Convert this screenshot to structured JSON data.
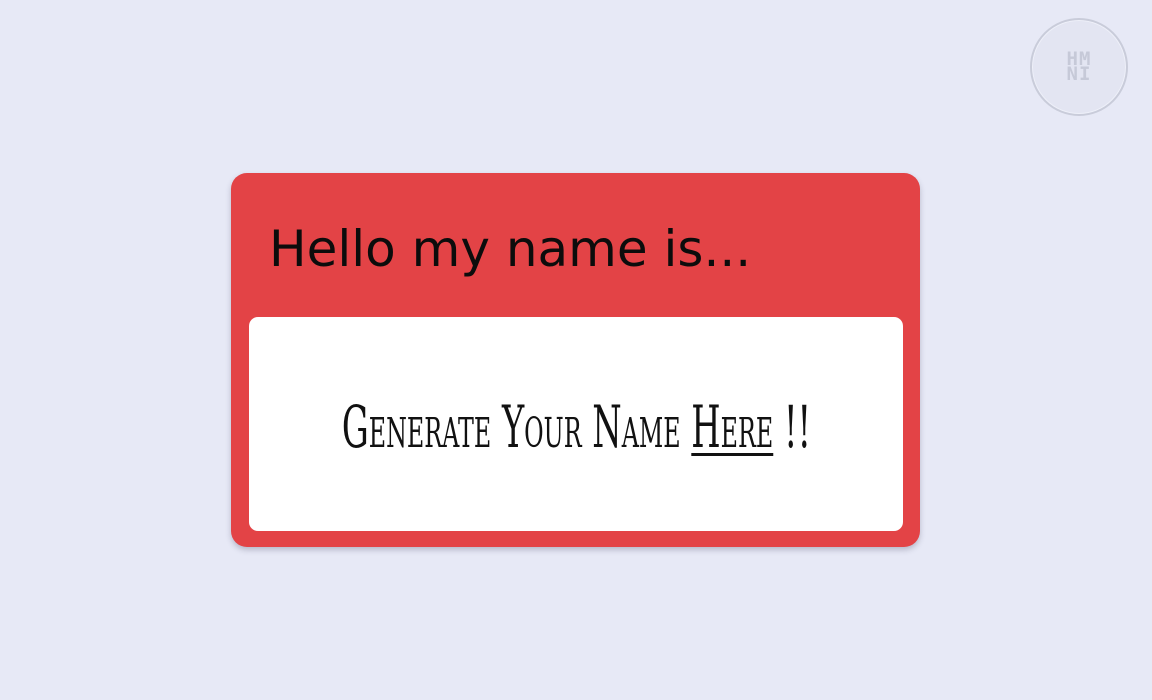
{
  "logo": {
    "line1": "HM",
    "line2": "NI"
  },
  "tag": {
    "header": "Hello my name is...",
    "prompt_text": "Generate Your Name",
    "link_text": "Here",
    "suffix": "!!"
  },
  "colors": {
    "background": "#e7e9f6",
    "tag_red": "#e34346",
    "card_white": "#ffffff"
  }
}
